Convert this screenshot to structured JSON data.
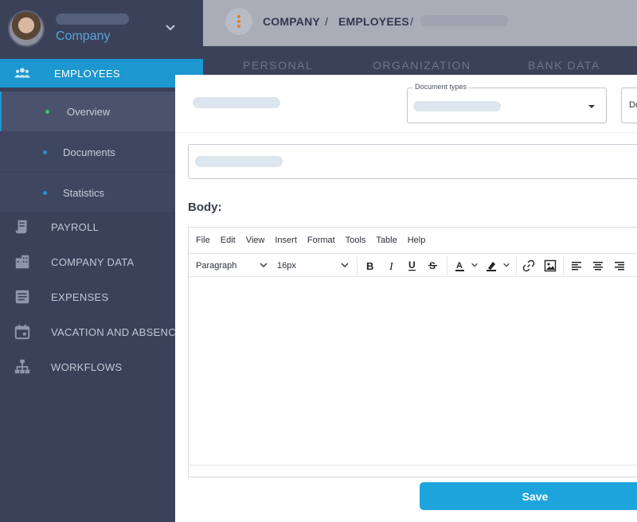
{
  "profile": {
    "company": "Company"
  },
  "nav": {
    "active": "EMPLOYEES",
    "sub_items": [
      "Overview",
      "Documents",
      "Statistics"
    ],
    "items": [
      "PAYROLL",
      "COMPANY DATA",
      "EXPENSES",
      "VACATION AND ABSENCES",
      "WORKFLOWS"
    ]
  },
  "breadcrumb": {
    "level1": "COMPANY",
    "sep": "/",
    "level2": "EMPLOYEES"
  },
  "tabs": [
    "PERSONAL",
    "ORGANIZATION",
    "BANK DATA"
  ],
  "modal": {
    "document_types_label": "Document types",
    "second_select_text": "Do",
    "body_label": "Body:",
    "menu": [
      "File",
      "Edit",
      "View",
      "Insert",
      "Format",
      "Tools",
      "Table",
      "Help"
    ],
    "block_format": "Paragraph",
    "font_size": "16px",
    "toolbar_icons": [
      "bold-icon",
      "italic-icon",
      "underline-icon",
      "strikethrough-icon",
      "text-color-icon",
      "highlight-icon",
      "link-icon",
      "image-icon",
      "align-left-icon",
      "align-center-icon",
      "align-right-icon"
    ],
    "save_label": "Save"
  },
  "colors": {
    "accent": "#1c97cf",
    "sidebar": "#3a4159",
    "active_dot": "#3ec27a",
    "kebab": "#e0802c"
  }
}
